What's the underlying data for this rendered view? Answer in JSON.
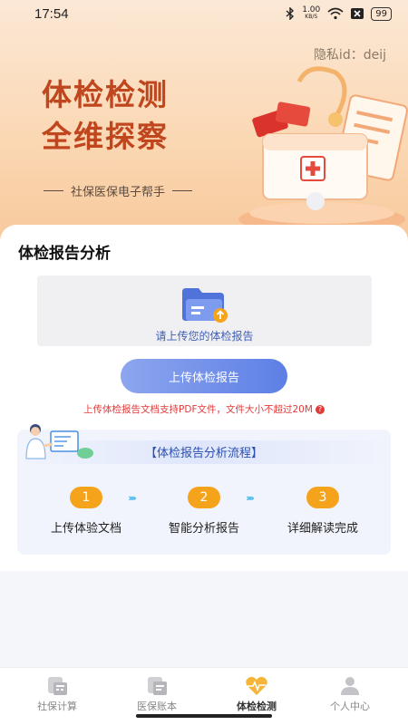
{
  "status": {
    "time": "17:54",
    "net_speed": "1.00",
    "net_unit": "KB/S",
    "battery": "99"
  },
  "hero": {
    "privacy_label": "隐私id：deij",
    "title_line1": "体检检测",
    "title_line2": "全维探察",
    "subtitle": "社保医保电子帮手"
  },
  "upload": {
    "section_title": "体检报告分析",
    "hint": "请上传您的体检报告",
    "button_label": "上传体检报告",
    "note": "上传体检报告文档支持PDF文件，文件大小不超过20M",
    "help_icon_glyph": "?"
  },
  "flow": {
    "title": "【体检报告分析流程】",
    "steps": [
      {
        "num": "1",
        "label": "上传体验文档"
      },
      {
        "num": "2",
        "label": "智能分析报告"
      },
      {
        "num": "3",
        "label": "详细解读完成"
      }
    ],
    "chevrons": "›››››"
  },
  "tabs": [
    {
      "label": "社保计算",
      "icon": "calculator-icon",
      "active": false
    },
    {
      "label": "医保账本",
      "icon": "ledger-icon",
      "active": false
    },
    {
      "label": "体检检测",
      "icon": "heart-pulse-icon",
      "active": true
    },
    {
      "label": "个人中心",
      "icon": "person-icon",
      "active": false
    }
  ],
  "colors": {
    "accent": "#5d7fe6",
    "hero_title": "#c0461e",
    "step": "#f5a31a",
    "warning": "#e03a3a"
  }
}
